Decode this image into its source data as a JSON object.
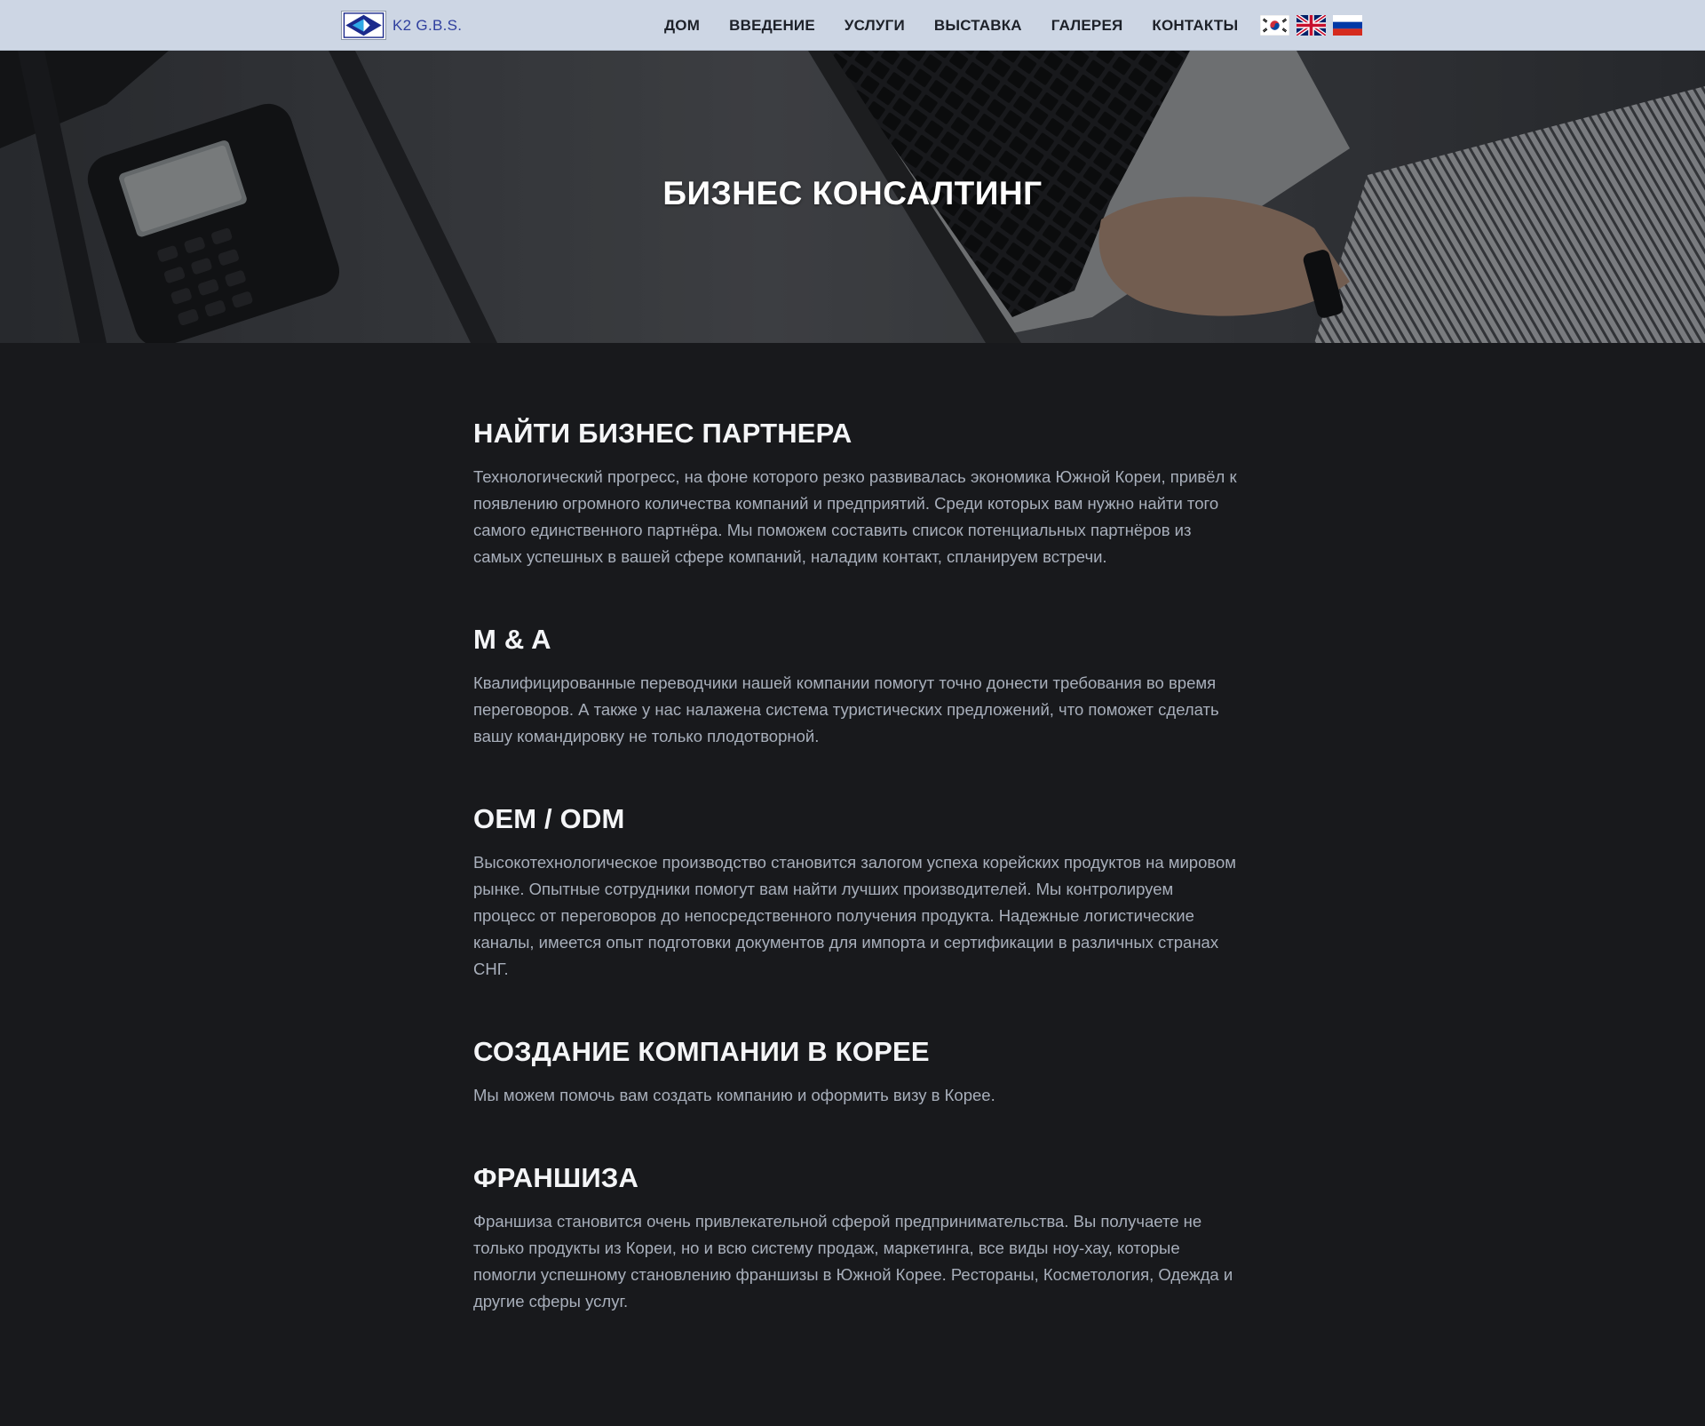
{
  "header": {
    "brand_name": "K2 G.B.S.",
    "nav": [
      {
        "label": "ДОМ"
      },
      {
        "label": "ВВЕДЕНИЕ"
      },
      {
        "label": "УСЛУГИ"
      },
      {
        "label": "ВЫСТАВКА"
      },
      {
        "label": "ГАЛЕРЕЯ"
      },
      {
        "label": "КОНТАКТЫ"
      }
    ],
    "flags": [
      "korea-flag-icon",
      "uk-flag-icon",
      "russia-flag-icon"
    ]
  },
  "hero": {
    "title": "БИЗНЕС КОНСАЛТИНГ",
    "image": "office-desk-laptop-phone-photo"
  },
  "services": [
    {
      "title": "НАЙТИ БИЗНЕС ПАРТНЕРА",
      "text": "Технологический прогресс, на фоне которого резко развивалась экономика Южной Кореи, привёл к появлению огромного количества компаний и предприятий. Среди которых вам нужно найти того самого единственного партнёра. Мы поможем составить список потенциальных партнёров из самых успешных в вашей сфере компаний, наладим контакт, спланируем встречи."
    },
    {
      "title": "M & A",
      "text": "Квалифицированные переводчики нашей компании помогут точно донести требования во время переговоров. А также у нас налажена система туристических предложений, что поможет сделать вашу командировку не только плодотворной."
    },
    {
      "title": "OEM / ODM",
      "text": "Высокотехнологическое производство становится залогом успеха корейских продуктов на мировом рынке. Опытные сотрудники помогут вам найти лучших производителей. Мы контролируем процесс от переговоров до непосредственного получения продукта. Надежные логистические каналы, имеется опыт подготовки документов для импорта и сертификации в различных странах СНГ."
    },
    {
      "title": "СОЗДАНИЕ КОМПАНИИ В КОРЕЕ",
      "text": "Мы можем помочь вам создать компанию и оформить визу в Корее."
    },
    {
      "title": "ФРАНШИЗА",
      "text": "Франшиза становится очень привлекательной сферой предпринимательства. Вы получаете не только продукты из Кореи, но и всю систему продаж, маркетинга, все виды ноу-хау, которые помогли успешному становлению франшизы в Южной Корее. Рестораны, Косметология, Одежда и другие сферы услуг."
    }
  ],
  "colors": {
    "nav_bg": "#cdd6e4",
    "brand": "#2f3f9e",
    "page_bg": "#18191c",
    "heading": "#f4f5f7",
    "body_text": "#a8afbb"
  }
}
